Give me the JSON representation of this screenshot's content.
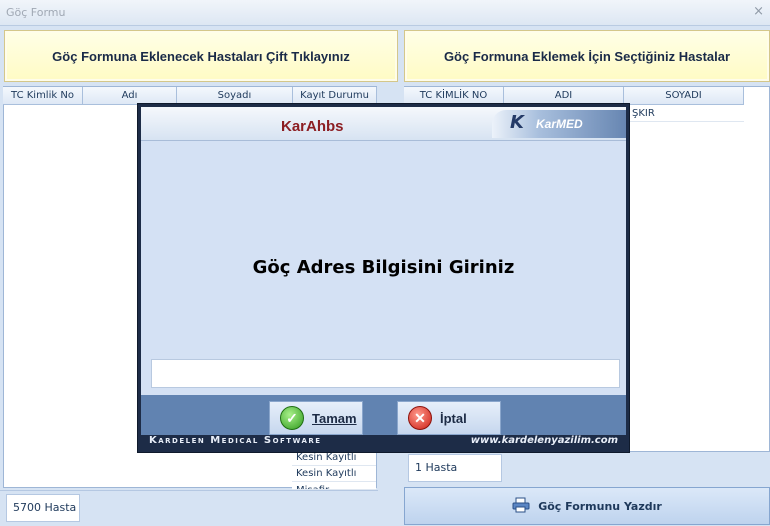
{
  "window": {
    "title": "Göç Formu",
    "close_glyph": "×"
  },
  "left_panel": {
    "header_button": "Göç Formuna Eklenecek Hastaları Çift Tıklayınız",
    "columns": [
      "TC Kimlik No",
      "Adı",
      "Soyadı",
      "Kayıt Durumu"
    ],
    "visible_cells": [
      "Kesin Kayıtlı",
      "Kesin Kayıtlı",
      "Misafir"
    ],
    "count": "5700 Hasta"
  },
  "right_panel": {
    "header_button": "Göç Formuna Eklemek İçin Seçtiğiniz Hastalar",
    "columns": [
      "TC KİMLİK NO",
      "ADI",
      "SOYADI"
    ],
    "visible_cells": [
      "ŞKIR"
    ],
    "count": "1 Hasta",
    "print_button": "Göç Formunu Yazdır"
  },
  "dialog": {
    "title": "KarAhbs",
    "brand": {
      "k": "K",
      "kar": "Kar",
      "med": "MED"
    },
    "message": "Göç Adres Bilgisini Giriniz",
    "input_value": "",
    "ok_label": "Tamam",
    "cancel_label": "İptal",
    "footer_left": "Kardelen Medical Software",
    "footer_right": "www.kardelenyazilim.com"
  },
  "icons": {
    "ok": "check-circle-icon",
    "cancel": "x-circle-icon",
    "print": "printer-icon"
  }
}
